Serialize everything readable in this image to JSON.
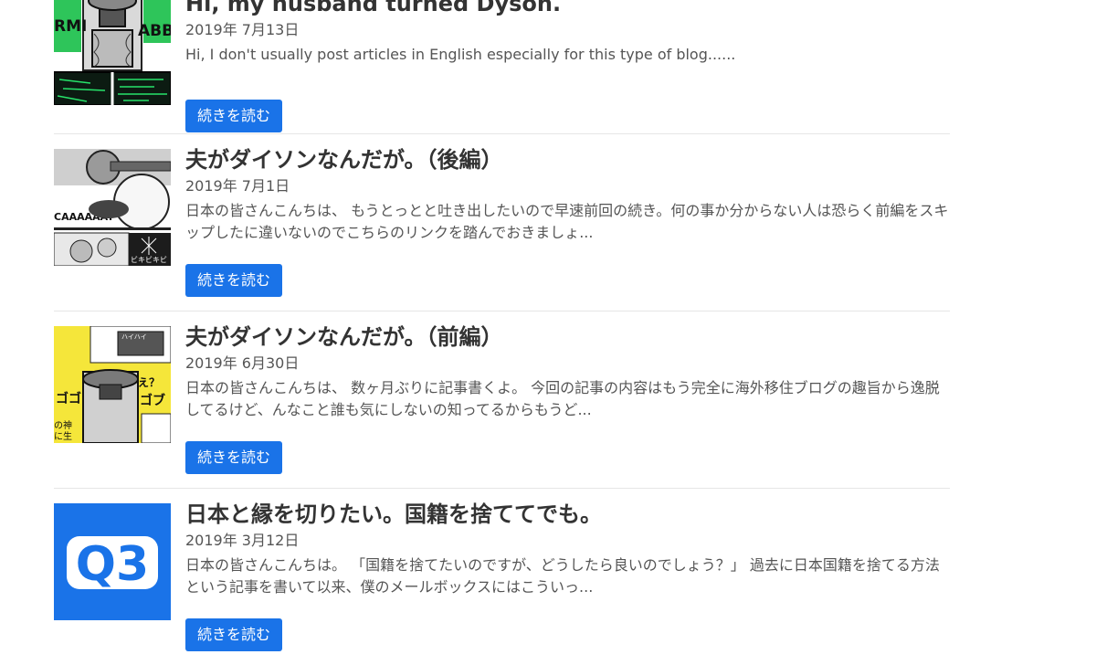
{
  "posts": [
    {
      "title": "Hi, my husband turned Dyson.",
      "date": "2019年 7月13日",
      "excerpt": "Hi, I don't usually post articles in English especially for this type of blog......",
      "button": "続きを読む"
    },
    {
      "title": "夫がダイソンなんだが。（後編）",
      "date": "2019年 7月1日",
      "excerpt": "日本の皆さんこんちは、 もうとっとと吐き出したいので早速前回の続き。何の事か分からない人は恐らく前編をスキップしたに違いないのでこちらのリンクを踏んでおきましょ...",
      "button": "続きを読む"
    },
    {
      "title": "夫がダイソンなんだが。（前編）",
      "date": "2019年 6月30日",
      "excerpt": "日本の皆さんこんちは、 数ヶ月ぶりに記事書くよ。 今回の記事の内容はもう完全に海外移住ブログの趣旨から逸脱してるけど、んなこと誰も気にしないの知ってるからもうど...",
      "button": "続きを読む"
    },
    {
      "title": "日本と縁を切りたい。国籍を捨ててでも。",
      "date": "2019年 3月12日",
      "excerpt": "日本の皆さんこんちは。 「国籍を捨てたいのですが、どうしたら良いのでしょう？」 過去に日本国籍を捨てる方法という記事を書いて以来、僕のメールボックスにはこういっ...",
      "button": "続きを読む"
    }
  ],
  "thumbnails": {
    "post1": {
      "text_left": "RMI",
      "text_right": "ABB",
      "accent": "#22dd55"
    },
    "post2": {
      "text_left": "CAAAAAAT",
      "text_right": "ビキビキビ"
    },
    "post3": {
      "text_top": "え？",
      "text_mid": "ゴゴ",
      "text_right": "ゴブ",
      "text_small": "ハイハイ",
      "text_left1": "の神",
      "text_left2": "に生",
      "accent": "#f5e63a"
    },
    "post4": {
      "logo_text": "Q3",
      "background": "#1a73e8"
    }
  }
}
